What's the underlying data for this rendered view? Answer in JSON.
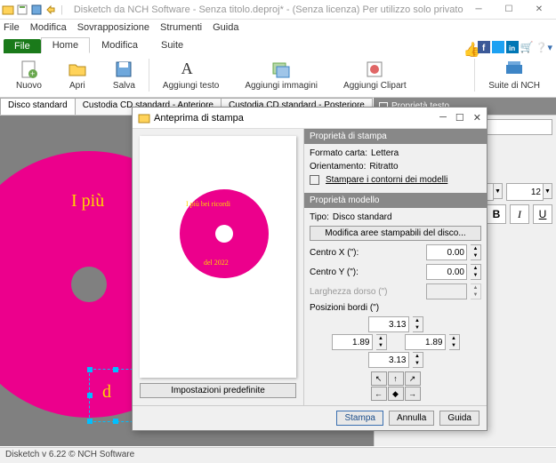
{
  "window": {
    "title": "Disketch da NCH Software - Senza titolo.deproj* - (Senza licenza) Per utilizzo solo privato non commerciale"
  },
  "menubar": [
    "File",
    "Modifica",
    "Sovrapposizione",
    "Strumenti",
    "Guida"
  ],
  "ribbon_tabs": {
    "file": "File",
    "tabs": [
      "Home",
      "Modifica",
      "Suite"
    ],
    "active": 0
  },
  "ribbon": {
    "nuovo": "Nuovo",
    "apri": "Apri",
    "salva": "Salva",
    "agg_testo": "Aggiungi testo",
    "agg_img": "Aggiungi immagini",
    "agg_clip": "Aggiungi Clipart",
    "suite": "Suite di NCH"
  },
  "doc_tabs": [
    "Disco standard",
    "Custodia CD standard - Anteriore",
    "Custodia CD standard - Posteriore"
  ],
  "canvas": {
    "line1": "I più",
    "line2": "d"
  },
  "side": {
    "header": "Proprietà testo",
    "text_value": "del 2022",
    "font_size": "12",
    "bold": "B",
    "italic": "I",
    "under": "U"
  },
  "dialog": {
    "title": "Anteprima di stampa",
    "preview_line1": "I più bei ricordi",
    "preview_line2": "del 2022",
    "defaults_btn": "Impostazioni predefinite",
    "sect_print": "Proprietà di stampa",
    "paper_label": "Formato carta:",
    "paper_value": "Lettera",
    "orient_label": "Orientamento:",
    "orient_value": "Ritratto",
    "outlines_label": "Stampare i contorni dei modelli",
    "sect_model": "Proprietà modello",
    "type_label": "Tipo:",
    "type_value": "Disco standard",
    "edit_areas_btn": "Modifica aree stampabili del disco...",
    "cx_label": "Centro X (\"):",
    "cx_value": "0.00",
    "cy_label": "Centro Y (\"):",
    "cy_value": "0.00",
    "spine_label": "Larghezza dorso (\")",
    "borders_label": "Posizioni bordi (\")",
    "border_top": "3.13",
    "border_left": "1.89",
    "border_right": "1.89",
    "border_bottom": "3.13",
    "btn_print": "Stampa",
    "btn_cancel": "Annulla",
    "btn_help": "Guida"
  },
  "status": "Disketch v 6.22 © NCH Software"
}
